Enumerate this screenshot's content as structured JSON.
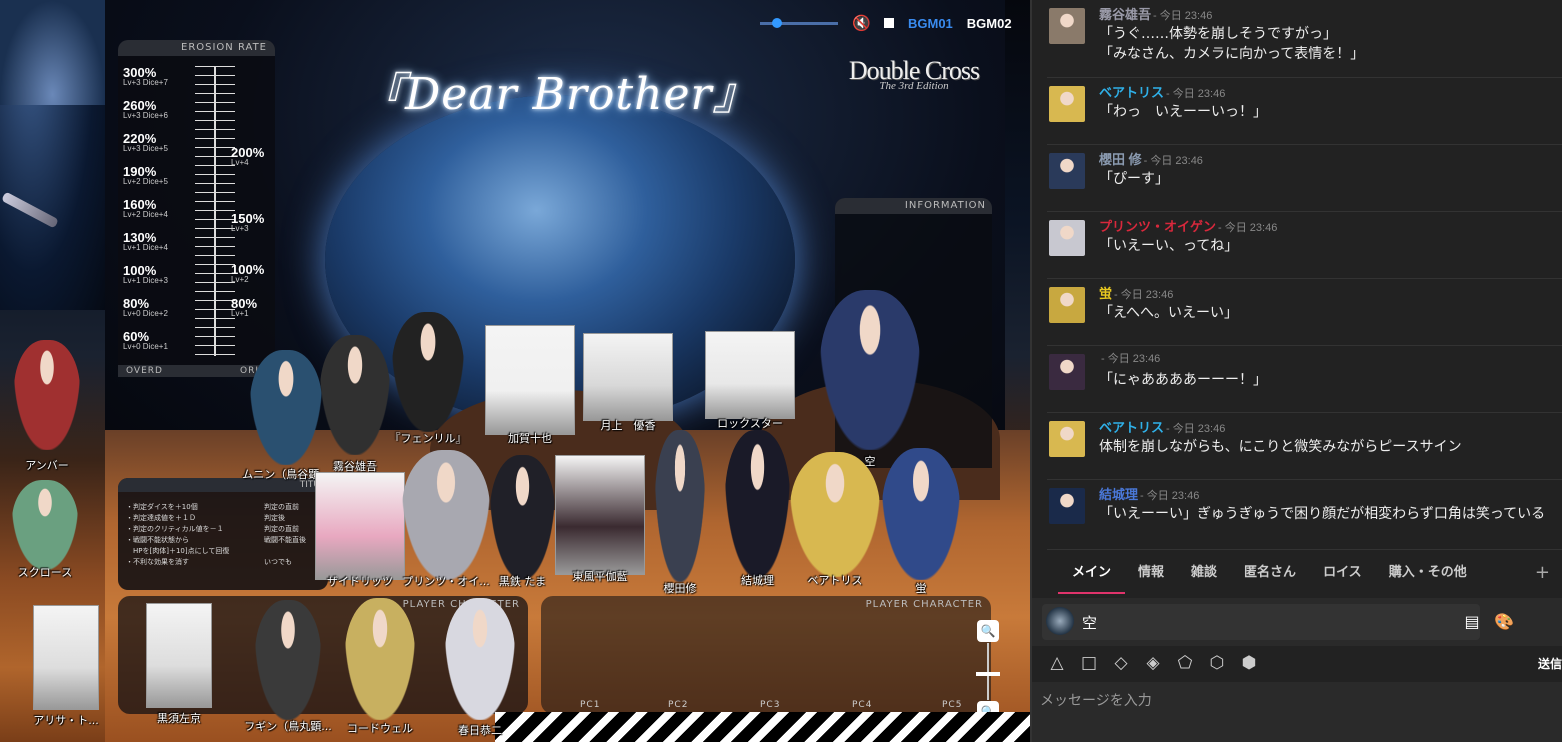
{
  "board": {
    "title": "『Dear Brother』",
    "logo_line1": "Double Cross",
    "logo_line2": "The 3rd Edition",
    "bgm1": "BGM01",
    "bgm2": "BGM02",
    "erosion_header": "EROSION RATE",
    "erosion_footer_left": "OVERD",
    "erosion_footer_right": "ORIG",
    "erosion_left": [
      {
        "p": "300%",
        "d": "Lv+3 Dice+7"
      },
      {
        "p": "260%",
        "d": "Lv+3 Dice+6"
      },
      {
        "p": "220%",
        "d": "Lv+3 Dice+5"
      },
      {
        "p": "190%",
        "d": "Lv+2 Dice+5"
      },
      {
        "p": "160%",
        "d": "Lv+2 Dice+4"
      },
      {
        "p": "130%",
        "d": "Lv+1 Dice+4"
      },
      {
        "p": "100%",
        "d": "Lv+1 Dice+3"
      },
      {
        "p": "80%",
        "d": "Lv+0 Dice+2"
      },
      {
        "p": "60%",
        "d": "Lv+0 Dice+1"
      }
    ],
    "erosion_right": [
      {
        "p": "200%",
        "d": "Lv+4"
      },
      {
        "p": "150%",
        "d": "Lv+3"
      },
      {
        "p": "100%",
        "d": "Lv+2"
      },
      {
        "p": "80%",
        "d": "Lv+1"
      }
    ],
    "information_header": "INFORMATION",
    "titus_header": "TITU",
    "titus_rules": [
      {
        "a": "・判定ダイスを＋10個",
        "b": "判定の直前"
      },
      {
        "a": "・判定達成値を＋１Ｄ",
        "b": "判定後"
      },
      {
        "a": "・判定のクリティカル値を－１",
        "b": "判定の直前"
      },
      {
        "a": "・戦闘不能状態から",
        "b": "戦闘不能直後"
      },
      {
        "a": "　HPを[肉体]＋10]点にして回復",
        "b": ""
      },
      {
        "a": "・不利な効果を消す",
        "b": "いつでも"
      }
    ],
    "pc_header": "PLAYER CHARACTER",
    "pc_slots": [
      "PC1",
      "PC2",
      "PC3",
      "PC4",
      "PC5"
    ],
    "characters": [
      "アンバー",
      "スクロース",
      "アリサ・ト...",
      "黒須左京",
      "フギン（鳥丸顕...",
      "コードウェル",
      "春日恭二",
      "ムニン（鳥谷顕...",
      "霧谷雄吾",
      "『フェンリル』",
      "加賀十也",
      "月上　優香",
      "ロックスター",
      "空",
      "ザイドリッツ",
      "プリンツ・オイ...",
      "黒鉄 たま",
      "東風平伽藍",
      "櫻田修",
      "結城理",
      "ベアトリス",
      "蛍"
    ]
  },
  "chat": {
    "messages": [
      {
        "name": "霧谷雄吾",
        "time": "- 今日 23:46",
        "color": "#9a9aa8",
        "lines": [
          "「うぐ……体勢を崩しそうですがっ」",
          "「みなさん、カメラに向かって表情を！」"
        ]
      },
      {
        "name": "ベアトリス",
        "time": "- 今日 23:46",
        "color": "#2fb0e8",
        "lines": [
          "「わっ　いえーーいっ！」"
        ]
      },
      {
        "name": "櫻田 修",
        "time": "- 今日 23:46",
        "color": "#8a9ab0",
        "lines": [
          "「ぴーす」"
        ]
      },
      {
        "name": "プリンツ・オイゲン",
        "time": "- 今日 23:46",
        "color": "#d8283c",
        "lines": [
          "「いえーい、ってね」"
        ]
      },
      {
        "name": "蛍",
        "time": "- 今日 23:46",
        "color": "#e8c820",
        "lines": [
          "「えへへ。いえーい」"
        ]
      },
      {
        "name": "",
        "time": "- 今日 23:46",
        "color": "#333",
        "lines": [
          "「にゃああああーーー！」"
        ]
      },
      {
        "name": "ベアトリス",
        "time": "- 今日 23:46",
        "color": "#2fb0e8",
        "lines": [
          "体制を崩しながらも、にこりと微笑みながらピースサイン"
        ]
      },
      {
        "name": "結城理",
        "time": "- 今日 23:46",
        "color": "#4a78d8",
        "lines": [
          "「いえーーい」ぎゅうぎゅうで困り顔だが相変わらず口角は笑っている"
        ]
      }
    ],
    "tabs": [
      "メイン",
      "情報",
      "雑談",
      "匿名さん",
      "ロイス",
      "購入・その他"
    ],
    "tab_plus": "+",
    "speaker": "空",
    "send": "送信",
    "input_placeholder": "メッセージを入力"
  }
}
